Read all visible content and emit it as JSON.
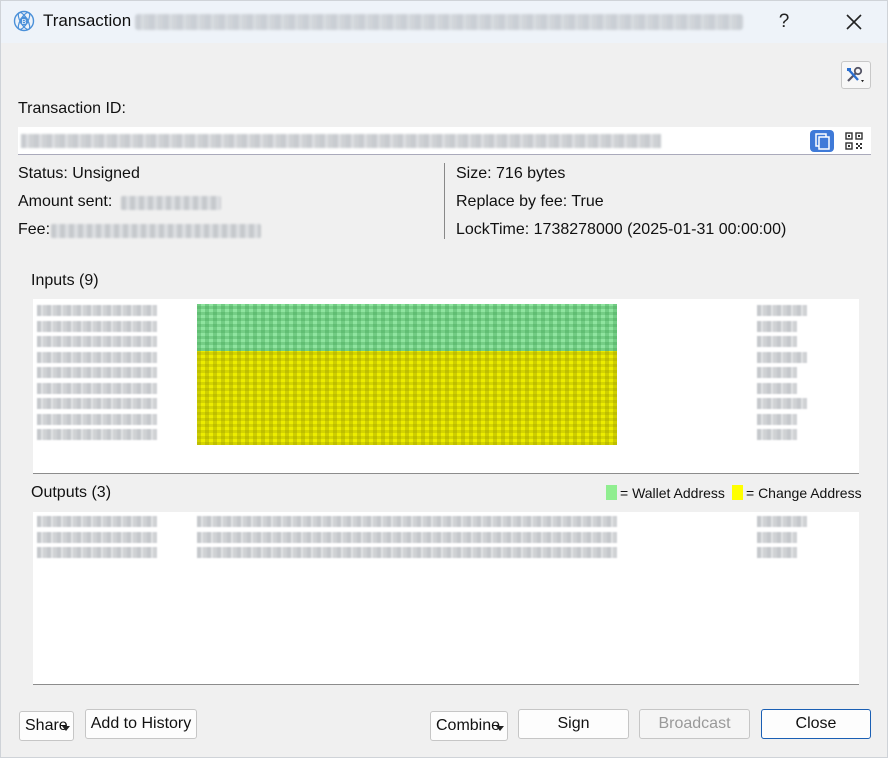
{
  "window": {
    "title": "Transaction",
    "help_label": "?"
  },
  "txid": {
    "label": "Transaction ID:"
  },
  "left_info": {
    "status": "Status: Unsigned",
    "amount_sent_label": "Amount sent:",
    "fee_label": "Fee:"
  },
  "right_info": {
    "size": "Size: 716 bytes",
    "replace_by_fee": "Replace by fee: True",
    "locktime": "LockTime: 1738278000 (2025-01-31 00:00:00)"
  },
  "inputs": {
    "label": "Inputs (9)",
    "count": 9,
    "wallet_rows": 3,
    "change_rows": 6
  },
  "outputs": {
    "label": "Outputs (3)",
    "count": 3
  },
  "legend": {
    "wallet_label": "= Wallet Address",
    "change_label": "= Change Address",
    "wallet_color": "#90ee90",
    "change_color": "#ffff00"
  },
  "buttons": {
    "share": "Share",
    "add_to_history": "Add to History",
    "combine": "Combine",
    "sign": "Sign",
    "broadcast": "Broadcast",
    "close": "Close"
  },
  "colors": {
    "accent": "#3f7ad8",
    "primary_border": "#1a5fb4"
  }
}
